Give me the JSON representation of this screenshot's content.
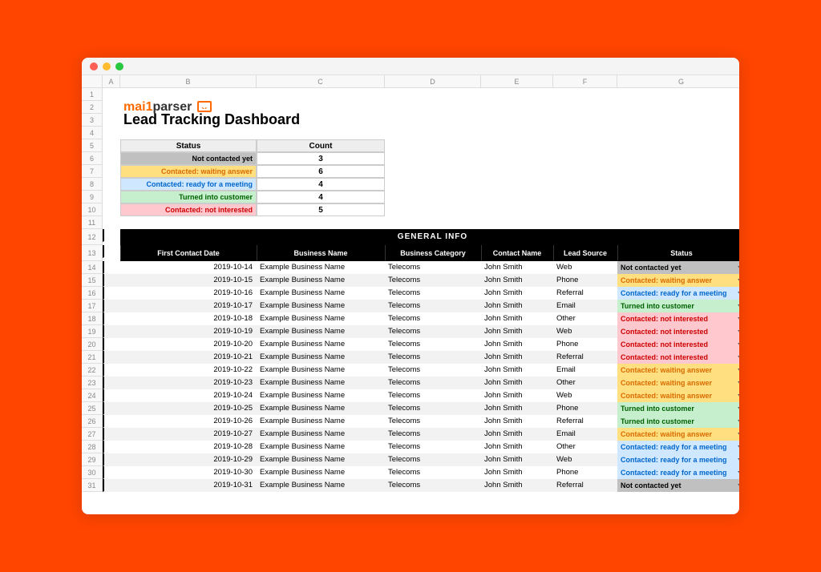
{
  "logo": {
    "mail": "mai",
    "one": "1",
    "parser": "parser"
  },
  "title": "Lead Tracking Dashboard",
  "columns": [
    "A",
    "B",
    "C",
    "D",
    "E",
    "F",
    "G"
  ],
  "row_numbers": [
    "1",
    "2",
    "3",
    "4",
    "5",
    "6",
    "7",
    "8",
    "9",
    "10",
    "11",
    "12",
    "13",
    "14",
    "15",
    "16",
    "17",
    "18",
    "19",
    "20",
    "21",
    "22",
    "23",
    "24",
    "25",
    "26",
    "27",
    "28",
    "29",
    "30",
    "31"
  ],
  "summary": {
    "headers": {
      "status": "Status",
      "count": "Count"
    },
    "rows": [
      {
        "label": "Not contacted yet",
        "count": "3",
        "cls": "stat-gray"
      },
      {
        "label": "Contacted: waiting answer",
        "count": "6",
        "cls": "stat-orange"
      },
      {
        "label": "Contacted: ready for a meeting",
        "count": "4",
        "cls": "stat-blue"
      },
      {
        "label": "Turned into customer",
        "count": "4",
        "cls": "stat-green"
      },
      {
        "label": "Contacted: not interested",
        "count": "5",
        "cls": "stat-red"
      }
    ]
  },
  "section_title": "GENERAL INFO",
  "table_headers": {
    "date": "First Contact Date",
    "business": "Business Name",
    "category": "Business Category",
    "contact": "Contact Name",
    "source": "Lead Source",
    "status": "Status"
  },
  "leads": [
    {
      "date": "2019-10-14",
      "business": "Example Business Name",
      "category": "Telecoms",
      "contact": "John Smith",
      "source": "Web",
      "status": "Not contacted yet",
      "cls": "stat-gray"
    },
    {
      "date": "2019-10-15",
      "business": "Example Business Name",
      "category": "Telecoms",
      "contact": "John Smith",
      "source": "Phone",
      "status": "Contacted: waiting answer",
      "cls": "stat-orange"
    },
    {
      "date": "2019-10-16",
      "business": "Example Business Name",
      "category": "Telecoms",
      "contact": "John Smith",
      "source": "Referral",
      "status": "Contacted: ready for a meeting",
      "cls": "stat-blue"
    },
    {
      "date": "2019-10-17",
      "business": "Example Business Name",
      "category": "Telecoms",
      "contact": "John Smith",
      "source": "Email",
      "status": "Turned into customer",
      "cls": "stat-green"
    },
    {
      "date": "2019-10-18",
      "business": "Example Business Name",
      "category": "Telecoms",
      "contact": "John Smith",
      "source": "Other",
      "status": "Contacted: not interested",
      "cls": "stat-red"
    },
    {
      "date": "2019-10-19",
      "business": "Example Business Name",
      "category": "Telecoms",
      "contact": "John Smith",
      "source": "Web",
      "status": "Contacted: not interested",
      "cls": "stat-red"
    },
    {
      "date": "2019-10-20",
      "business": "Example Business Name",
      "category": "Telecoms",
      "contact": "John Smith",
      "source": "Phone",
      "status": "Contacted: not interested",
      "cls": "stat-red"
    },
    {
      "date": "2019-10-21",
      "business": "Example Business Name",
      "category": "Telecoms",
      "contact": "John Smith",
      "source": "Referral",
      "status": "Contacted: not interested",
      "cls": "stat-red"
    },
    {
      "date": "2019-10-22",
      "business": "Example Business Name",
      "category": "Telecoms",
      "contact": "John Smith",
      "source": "Email",
      "status": "Contacted: waiting answer",
      "cls": "stat-orange"
    },
    {
      "date": "2019-10-23",
      "business": "Example Business Name",
      "category": "Telecoms",
      "contact": "John Smith",
      "source": "Other",
      "status": "Contacted: waiting answer",
      "cls": "stat-orange"
    },
    {
      "date": "2019-10-24",
      "business": "Example Business Name",
      "category": "Telecoms",
      "contact": "John Smith",
      "source": "Web",
      "status": "Contacted: waiting answer",
      "cls": "stat-orange"
    },
    {
      "date": "2019-10-25",
      "business": "Example Business Name",
      "category": "Telecoms",
      "contact": "John Smith",
      "source": "Phone",
      "status": "Turned into customer",
      "cls": "stat-green"
    },
    {
      "date": "2019-10-26",
      "business": "Example Business Name",
      "category": "Telecoms",
      "contact": "John Smith",
      "source": "Referral",
      "status": "Turned into customer",
      "cls": "stat-green"
    },
    {
      "date": "2019-10-27",
      "business": "Example Business Name",
      "category": "Telecoms",
      "contact": "John Smith",
      "source": "Email",
      "status": "Contacted: waiting answer",
      "cls": "stat-orange"
    },
    {
      "date": "2019-10-28",
      "business": "Example Business Name",
      "category": "Telecoms",
      "contact": "John Smith",
      "source": "Other",
      "status": "Contacted: ready for a meeting",
      "cls": "stat-blue"
    },
    {
      "date": "2019-10-29",
      "business": "Example Business Name",
      "category": "Telecoms",
      "contact": "John Smith",
      "source": "Web",
      "status": "Contacted: ready for a meeting",
      "cls": "stat-blue"
    },
    {
      "date": "2019-10-30",
      "business": "Example Business Name",
      "category": "Telecoms",
      "contact": "John Smith",
      "source": "Phone",
      "status": "Contacted: ready for a meeting",
      "cls": "stat-blue"
    },
    {
      "date": "2019-10-31",
      "business": "Example Business Name",
      "category": "Telecoms",
      "contact": "John Smith",
      "source": "Referral",
      "status": "Not contacted yet",
      "cls": "stat-gray"
    }
  ]
}
